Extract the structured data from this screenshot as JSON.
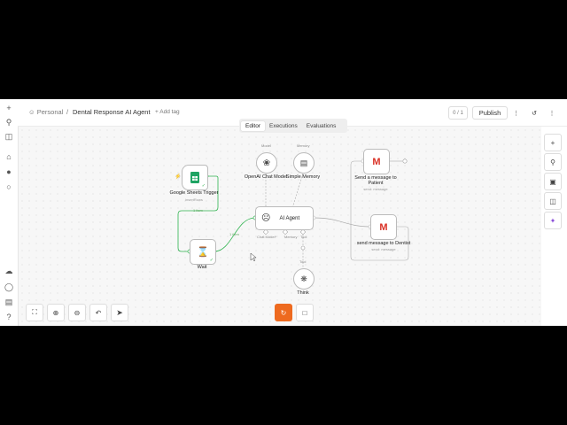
{
  "topbar": {
    "workspace": "Personal",
    "separator": "/",
    "workflow_name": "Dental Response AI Agent",
    "add_tag": "+ Add tag",
    "counter": "0 / 1",
    "publish": "Publish"
  },
  "tabs": [
    "Editor",
    "Executions",
    "Evaluations"
  ],
  "nodes": {
    "sheets": {
      "label": "Google Sheets Trigger",
      "sub": "insertRows"
    },
    "wait": {
      "label": "Wait"
    },
    "agent": {
      "label": "AI Agent"
    },
    "openai": {
      "label": "OpenAI Chat Model",
      "top": "Model"
    },
    "memory": {
      "label": "Simple Memory",
      "top": "Memory"
    },
    "gmail1": {
      "label": "Send a message to",
      "label2": "Patient",
      "sub": "send: message"
    },
    "gmail2": {
      "label": "send message to Dentist",
      "sub": "send: message"
    },
    "think": {
      "label": "Think",
      "top": "Tool"
    }
  },
  "ports": {
    "chat_model": "Chat Model*",
    "memory": "Memory",
    "tool": "Tool"
  },
  "edge_labels": {
    "sheets_wait": "1 item",
    "wait_agent": "1 item"
  },
  "colors": {
    "accent": "#ff6d3a",
    "run_button": "#ee6a1f",
    "sheets": "#1fa463",
    "success": "#2fb34f"
  },
  "icons": {
    "sidebar": [
      "plus-icon",
      "search-icon",
      "panel-icon",
      "home-icon",
      "user-icon",
      "chat-icon",
      "cloud-icon",
      "shield-icon",
      "chart-icon",
      "help-icon"
    ],
    "right_tools": [
      "plus-icon",
      "search-icon",
      "sticky-note-icon",
      "panel-icon",
      "sparkle-icon"
    ],
    "bottom_tools": [
      "fit-view-icon",
      "zoom-in-icon",
      "zoom-out-icon",
      "undo-icon",
      "cursor-icon"
    ]
  }
}
